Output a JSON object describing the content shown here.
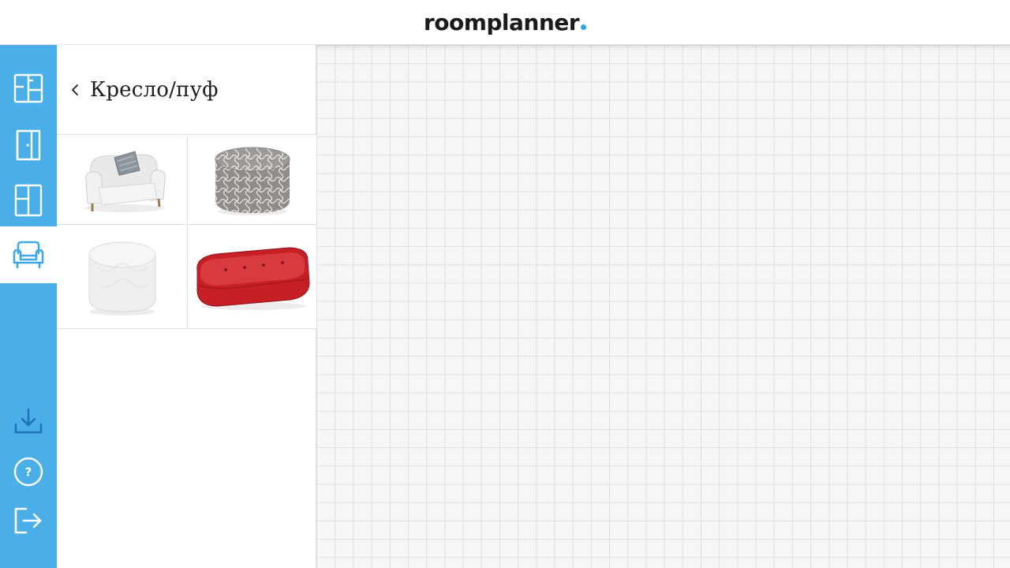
{
  "header": {
    "logo_text": "roomplanner",
    "logo_dot_color": "#2ea3e6"
  },
  "rail": {
    "color": "#4aaee8",
    "top_items": [
      {
        "icon": "floorplan-icon",
        "active": false
      },
      {
        "icon": "door-icon",
        "active": false
      },
      {
        "icon": "window-icon",
        "active": false
      },
      {
        "icon": "armchair-icon",
        "active": true
      }
    ],
    "bottom_items": [
      {
        "icon": "download-icon"
      },
      {
        "icon": "help-icon"
      },
      {
        "icon": "logout-icon"
      }
    ]
  },
  "panel": {
    "back_icon": "chevron-left-icon",
    "title": "Кресло/пуф",
    "items": [
      {
        "name": "white-armchair",
        "icon": "armchair-thumbnail"
      },
      {
        "name": "patterned-pouf",
        "icon": "pouf-thumbnail"
      },
      {
        "name": "white-pouf",
        "icon": "pouf-thumbnail"
      },
      {
        "name": "red-bench",
        "icon": "bench-thumbnail"
      }
    ]
  }
}
